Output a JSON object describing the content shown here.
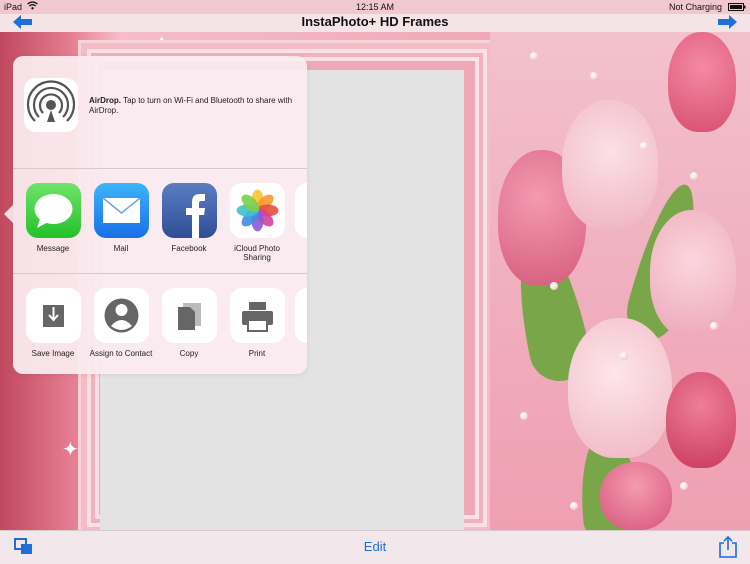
{
  "status_bar": {
    "device": "iPad",
    "time": "12:15 AM",
    "battery": "Not Charging"
  },
  "nav": {
    "title": "InstaPhoto+ HD Frames"
  },
  "toolbar": {
    "edit_label": "Edit"
  },
  "share_sheet": {
    "airdrop_text_bold": "AirDrop.",
    "airdrop_text": " Tap to turn on Wi-Fi and Bluetooth to share with AirDrop.",
    "share_apps": [
      {
        "label": "Message",
        "icon": "message-icon"
      },
      {
        "label": "Mail",
        "icon": "mail-icon"
      },
      {
        "label": "Facebook",
        "icon": "facebook-icon"
      },
      {
        "label": "iCloud Photo Sharing",
        "icon": "icloud-photo-sharing-icon"
      }
    ],
    "actions": [
      {
        "label": "Save Image",
        "icon": "save-image-icon"
      },
      {
        "label": "Assign to Contact",
        "icon": "contact-icon"
      },
      {
        "label": "Copy",
        "icon": "copy-icon"
      },
      {
        "label": "Print",
        "icon": "print-icon"
      }
    ]
  },
  "colors": {
    "accent": "#1e6fd9",
    "frame": "#eea9b5"
  }
}
